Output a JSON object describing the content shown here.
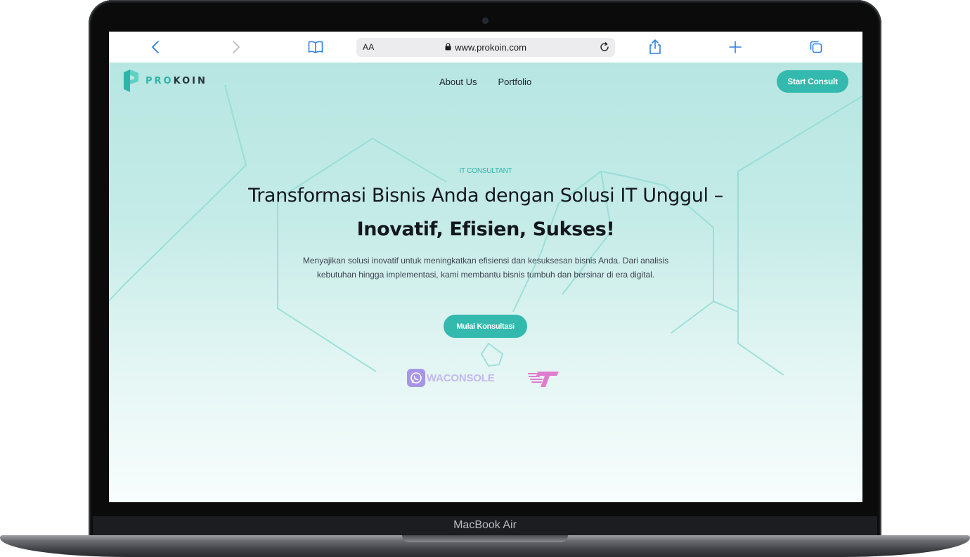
{
  "device": {
    "model_label": "MacBook Air"
  },
  "browser": {
    "text_size_label": "AA",
    "url": "www.prokoin.com",
    "icons": {
      "back": "chevron-left-icon",
      "forward": "chevron-right-icon",
      "bookmarks": "book-icon",
      "lock": "lock-icon",
      "reload": "reload-icon",
      "share": "share-icon",
      "new_tab": "plus-icon",
      "tabs": "tabs-icon"
    },
    "accent_color": "#2f7fe0"
  },
  "site": {
    "brand": {
      "name_accent": "PRO",
      "name_rest": "KOIN",
      "accent_color": "#2fb4a8"
    },
    "nav": [
      {
        "label": "About Us"
      },
      {
        "label": "Portfolio"
      }
    ],
    "header_cta": "Start Consult",
    "hero": {
      "eyebrow": "IT CONSULTANT",
      "headline_regular": "Transformasi Bisnis Anda dengan Solusi IT Unggul – ",
      "headline_bold": "Inovatif, Efisien, Sukses!",
      "description": "Menyajikan solusi inovatif untuk meningkatkan efisiensi dan kesuksesan bisnis Anda. Dari analisis kebutuhan hingga implementasi, kami membantu bisnis tumbuh dan bersinar di era digital.",
      "cta": "Mulai Konsultasi"
    },
    "partners": [
      {
        "name": "WACONSOLE",
        "icon": "whatsapp-icon",
        "color": "#a796e8"
      },
      {
        "name": "",
        "icon": "t-logo-icon",
        "color": "#e07cd0"
      }
    ],
    "cta_color": "#33b9ad"
  }
}
